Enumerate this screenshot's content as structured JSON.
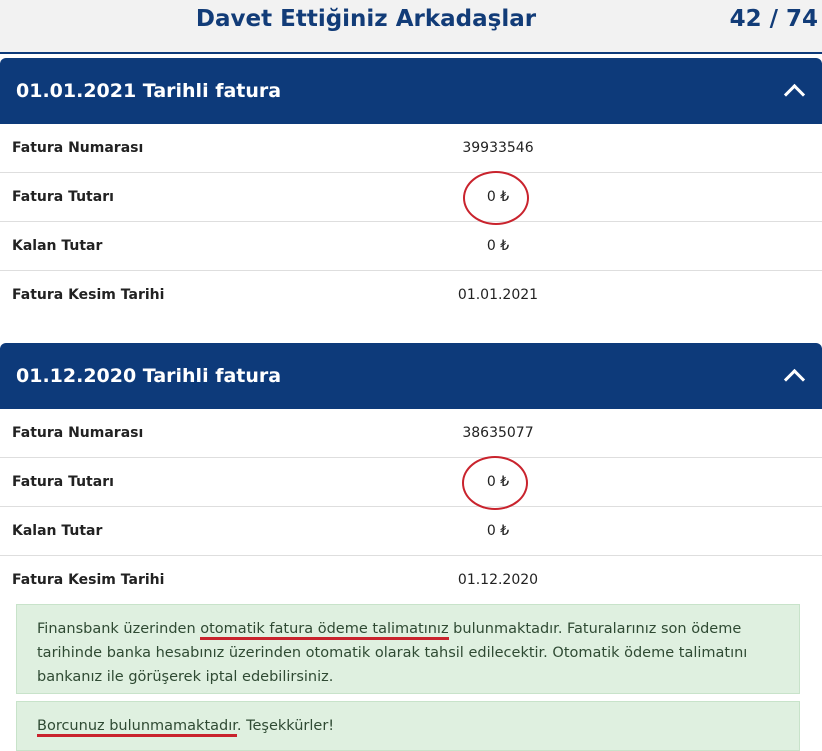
{
  "header": {
    "title": "Davet Ettiğiniz Arkadaşlar",
    "counter": "42 / 74"
  },
  "invoices": [
    {
      "title": "01.01.2021 Tarihli fatura",
      "rows": [
        {
          "label": "Fatura Numarası",
          "value": "39933546"
        },
        {
          "label": "Fatura Tutarı",
          "value": "0 ₺"
        },
        {
          "label": "Kalan Tutar",
          "value": "0 ₺"
        },
        {
          "label": "Fatura Kesim Tarihi",
          "value": "01.01.2021"
        }
      ]
    },
    {
      "title": "01.12.2020 Tarihli fatura",
      "rows": [
        {
          "label": "Fatura Numarası",
          "value": "38635077"
        },
        {
          "label": "Fatura Tutarı",
          "value": "0 ₺"
        },
        {
          "label": "Kalan Tutar",
          "value": "0 ₺"
        },
        {
          "label": "Fatura Kesim Tarihi",
          "value": "01.12.2020"
        }
      ]
    }
  ],
  "autopay_notice": {
    "part1": "Finansbank üzerinden ",
    "highlight": "otomatik fatura ödeme talimatınız",
    "part2": " bulunmaktadır. Faturalarınız son ödeme tarihinde banka hesabınız üzerinden otomatik olarak tahsil edilecektir. Otomatik ödeme talimatını bankanız ile görüşerek iptal edebilirsiniz."
  },
  "debt_notice": {
    "highlight": "Borcunuz bulunmamaktadır",
    "rest": ". Teşekkürler!"
  },
  "colors": {
    "primary": "#0d3a7a",
    "annotation": "#c9232d",
    "success_bg": "#dff0e0"
  },
  "icons": {
    "collapse": "chevron-up-icon"
  }
}
